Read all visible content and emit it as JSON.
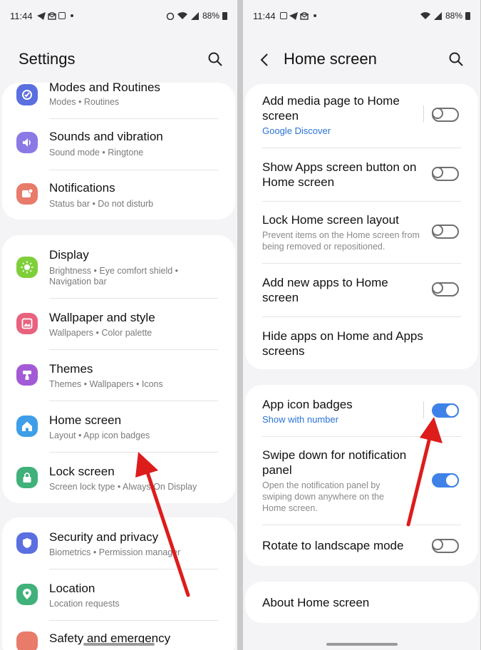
{
  "left": {
    "status": {
      "time": "11:44",
      "battery": "88%"
    },
    "title": "Settings",
    "items": [
      {
        "title": "Modes and Routines",
        "sub": "Modes  •  Routines",
        "color": "#5a6fe0"
      },
      {
        "title": "Sounds and vibration",
        "sub": "Sound mode  •  Ringtone",
        "color": "#8b79e6"
      },
      {
        "title": "Notifications",
        "sub": "Status bar  •  Do not disturb",
        "color": "#e87b6a"
      },
      {
        "title": "Display",
        "sub": "Brightness  •  Eye comfort shield  •",
        "sub2": "Navigation bar",
        "color": "#7fcf3a"
      },
      {
        "title": "Wallpaper and style",
        "sub": "Wallpapers  •  Color palette",
        "color": "#e8627e"
      },
      {
        "title": "Themes",
        "sub": "Themes  •  Wallpapers  •  Icons",
        "color": "#a35ad6"
      },
      {
        "title": "Home screen",
        "sub": "Layout  •  App icon badges",
        "color": "#3f9ee8"
      },
      {
        "title": "Lock screen",
        "sub": "Screen lock type  •  Always On Display",
        "color": "#40b17a"
      },
      {
        "title": "Security and privacy",
        "sub": "Biometrics  •  Permission manager",
        "color": "#5a6fe0"
      },
      {
        "title": "Location",
        "sub": "Location requests",
        "color": "#40b17a"
      },
      {
        "title": "Safety and emergency",
        "color": "#e87b6a"
      }
    ]
  },
  "right": {
    "status": {
      "time": "11:44",
      "battery": "88%"
    },
    "title": "Home screen",
    "accent": "#3e82e8",
    "items": [
      {
        "title": "Add media page to Home screen",
        "link": "Google Discover",
        "toggle": "off"
      },
      {
        "title": "Show Apps screen button on Home screen",
        "toggle": "off"
      },
      {
        "title": "Lock Home screen layout",
        "sub": "Prevent items on the Home screen from being removed or repositioned.",
        "toggle": "off"
      },
      {
        "title": "Add new apps to Home screen",
        "toggle": "off"
      },
      {
        "title": "Hide apps on Home and Apps screens"
      },
      {
        "title": "App icon badges",
        "link": "Show with number",
        "toggle": "on"
      },
      {
        "title": "Swipe down for notification panel",
        "sub": "Open the notification panel by swiping down anywhere on the Home screen.",
        "toggle": "on"
      },
      {
        "title": "Rotate to landscape mode",
        "toggle": "off"
      },
      {
        "title": "About Home screen"
      }
    ]
  }
}
